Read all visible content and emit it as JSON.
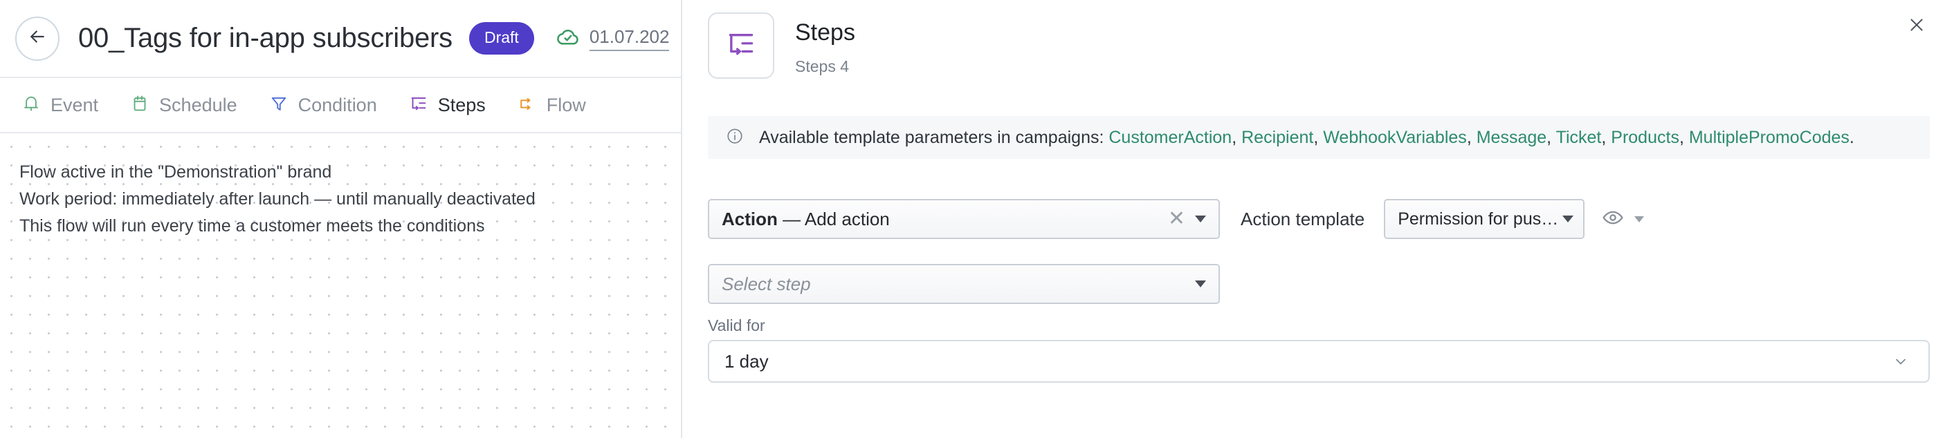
{
  "header": {
    "back_icon": "arrow-left-icon",
    "title": "00_Tags for in-app subscribers",
    "status_badge": "Draft",
    "saved_icon": "cloud-check-icon",
    "saved_date": "01.07.202"
  },
  "tabs": [
    {
      "label": "Event",
      "icon": "bell-icon",
      "color": "#5fae7e",
      "active": false
    },
    {
      "label": "Schedule",
      "icon": "calendar-icon",
      "color": "#5fae7e",
      "active": false
    },
    {
      "label": "Condition",
      "icon": "filter-icon",
      "color": "#4f6fd8",
      "active": false
    },
    {
      "label": "Steps",
      "icon": "steps-icon",
      "color": "#8e4fc0",
      "active": true
    },
    {
      "label": "Flow",
      "icon": "flow-icon",
      "color": "#e8962f",
      "active": false
    }
  ],
  "canvas": {
    "lines": [
      "Flow active in the \"Demonstration\" brand",
      "Work period: immediately after launch — until manually deactivated",
      "This flow will run every time a customer meets the conditions"
    ]
  },
  "panel": {
    "icon": "steps-icon",
    "title": "Steps",
    "subtitle": "Steps 4",
    "close_icon": "close-icon",
    "banner": {
      "icon": "info-icon",
      "prefix": "Available template parameters in campaigns: ",
      "params": [
        "CustomerAction",
        "Recipient",
        "WebhookVariables",
        "Message",
        "Ticket",
        "Products",
        "MultiplePromoCodes"
      ],
      "suffix": "."
    },
    "action_field": {
      "label_bold": "Action",
      "value": " — Add action",
      "clear_icon": "close-x-icon",
      "dropdown_icon": "caret-down-icon"
    },
    "action_template": {
      "label": "Action template",
      "value": "Permission for push notification fro...",
      "dropdown_icon": "caret-down-icon",
      "preview_icon": "eye-icon",
      "preview_caret_icon": "caret-down-icon"
    },
    "step_field": {
      "placeholder": "Select step",
      "dropdown_icon": "caret-down-icon"
    },
    "valid_for": {
      "label": "Valid for",
      "value": "1 day",
      "chevron_icon": "chevron-down-icon"
    }
  },
  "colors": {
    "badge_purple": "#4f3cc9",
    "link_green": "#2e8b6b",
    "banner_bg": "#f5f7f9"
  }
}
